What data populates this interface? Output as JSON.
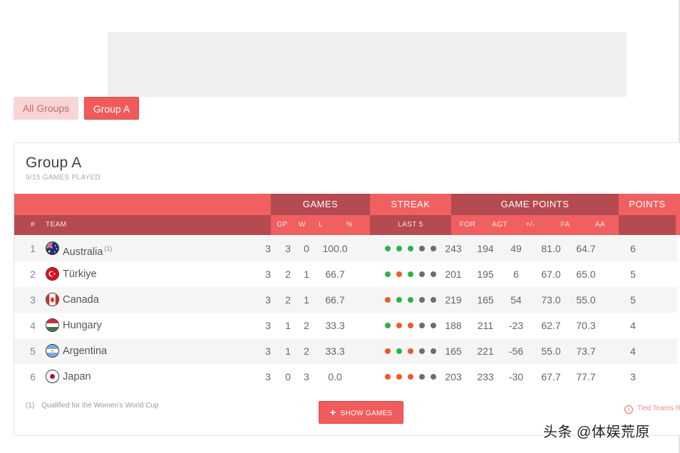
{
  "filters": {
    "all_label": "All Groups",
    "group_a_label": "Group A"
  },
  "group": {
    "title": "Group A",
    "subtitle": "9/15 GAMES PLAYED"
  },
  "header": {
    "games": "GAMES",
    "streak": "STREAK",
    "game_points": "GAME POINTS",
    "points": "POINTS",
    "rank": "#",
    "team": "TEAM",
    "gp": "GP",
    "w": "W",
    "l": "L",
    "pct": "%",
    "last5": "LAST 5",
    "for": "FOR",
    "agt": "AGT",
    "diff": "+/-",
    "fa": "FA",
    "aa": "AA"
  },
  "rows": [
    {
      "rank": "1",
      "team": "Australia",
      "note": "(1)",
      "flag": "australia-flag-icon",
      "gp": "3",
      "w": "3",
      "l": "0",
      "pct": "100.0",
      "streak": [
        "W",
        "W",
        "W",
        "N",
        "N"
      ],
      "for": "243",
      "agt": "194",
      "diff": "49",
      "fa": "81.0",
      "aa": "64.7",
      "points": "6"
    },
    {
      "rank": "2",
      "team": "Türkiye",
      "note": "",
      "flag": "turkiye-flag-icon",
      "gp": "3",
      "w": "2",
      "l": "1",
      "pct": "66.7",
      "streak": [
        "W",
        "L",
        "W",
        "N",
        "N"
      ],
      "for": "201",
      "agt": "195",
      "diff": "6",
      "fa": "67.0",
      "aa": "65.0",
      "points": "5"
    },
    {
      "rank": "3",
      "team": "Canada",
      "note": "",
      "flag": "canada-flag-icon",
      "gp": "3",
      "w": "2",
      "l": "1",
      "pct": "66.7",
      "streak": [
        "L",
        "W",
        "W",
        "N",
        "N"
      ],
      "for": "219",
      "agt": "165",
      "diff": "54",
      "fa": "73.0",
      "aa": "55.0",
      "points": "5"
    },
    {
      "rank": "4",
      "team": "Hungary",
      "note": "",
      "flag": "hungary-flag-icon",
      "gp": "3",
      "w": "1",
      "l": "2",
      "pct": "33.3",
      "streak": [
        "W",
        "L",
        "L",
        "N",
        "N"
      ],
      "for": "188",
      "agt": "211",
      "diff": "-23",
      "fa": "62.7",
      "aa": "70.3",
      "points": "4"
    },
    {
      "rank": "5",
      "team": "Argentina",
      "note": "",
      "flag": "argentina-flag-icon",
      "gp": "3",
      "w": "1",
      "l": "2",
      "pct": "33.3",
      "streak": [
        "L",
        "W",
        "L",
        "N",
        "N"
      ],
      "for": "165",
      "agt": "221",
      "diff": "-56",
      "fa": "55.0",
      "aa": "73.7",
      "points": "4"
    },
    {
      "rank": "6",
      "team": "Japan",
      "note": "",
      "flag": "japan-flag-icon",
      "gp": "3",
      "w": "0",
      "l": "3",
      "pct": "0.0",
      "streak": [
        "L",
        "L",
        "L",
        "N",
        "N"
      ],
      "for": "203",
      "agt": "233",
      "diff": "-30",
      "fa": "67.7",
      "aa": "77.7",
      "points": "3"
    }
  ],
  "footer": {
    "note_num": "(1)",
    "note_text": "Qualified for the Women's World Cup",
    "show_games": "SHOW GAMES",
    "tied": "Tied Teams R"
  },
  "watermark": "头条 @体娱荒原",
  "colors": {
    "accent": "#f06060",
    "accent_dark": "#b54a50",
    "win": "#2bb34a",
    "loss": "#ef5a2b",
    "none": "#6e6e6e"
  }
}
